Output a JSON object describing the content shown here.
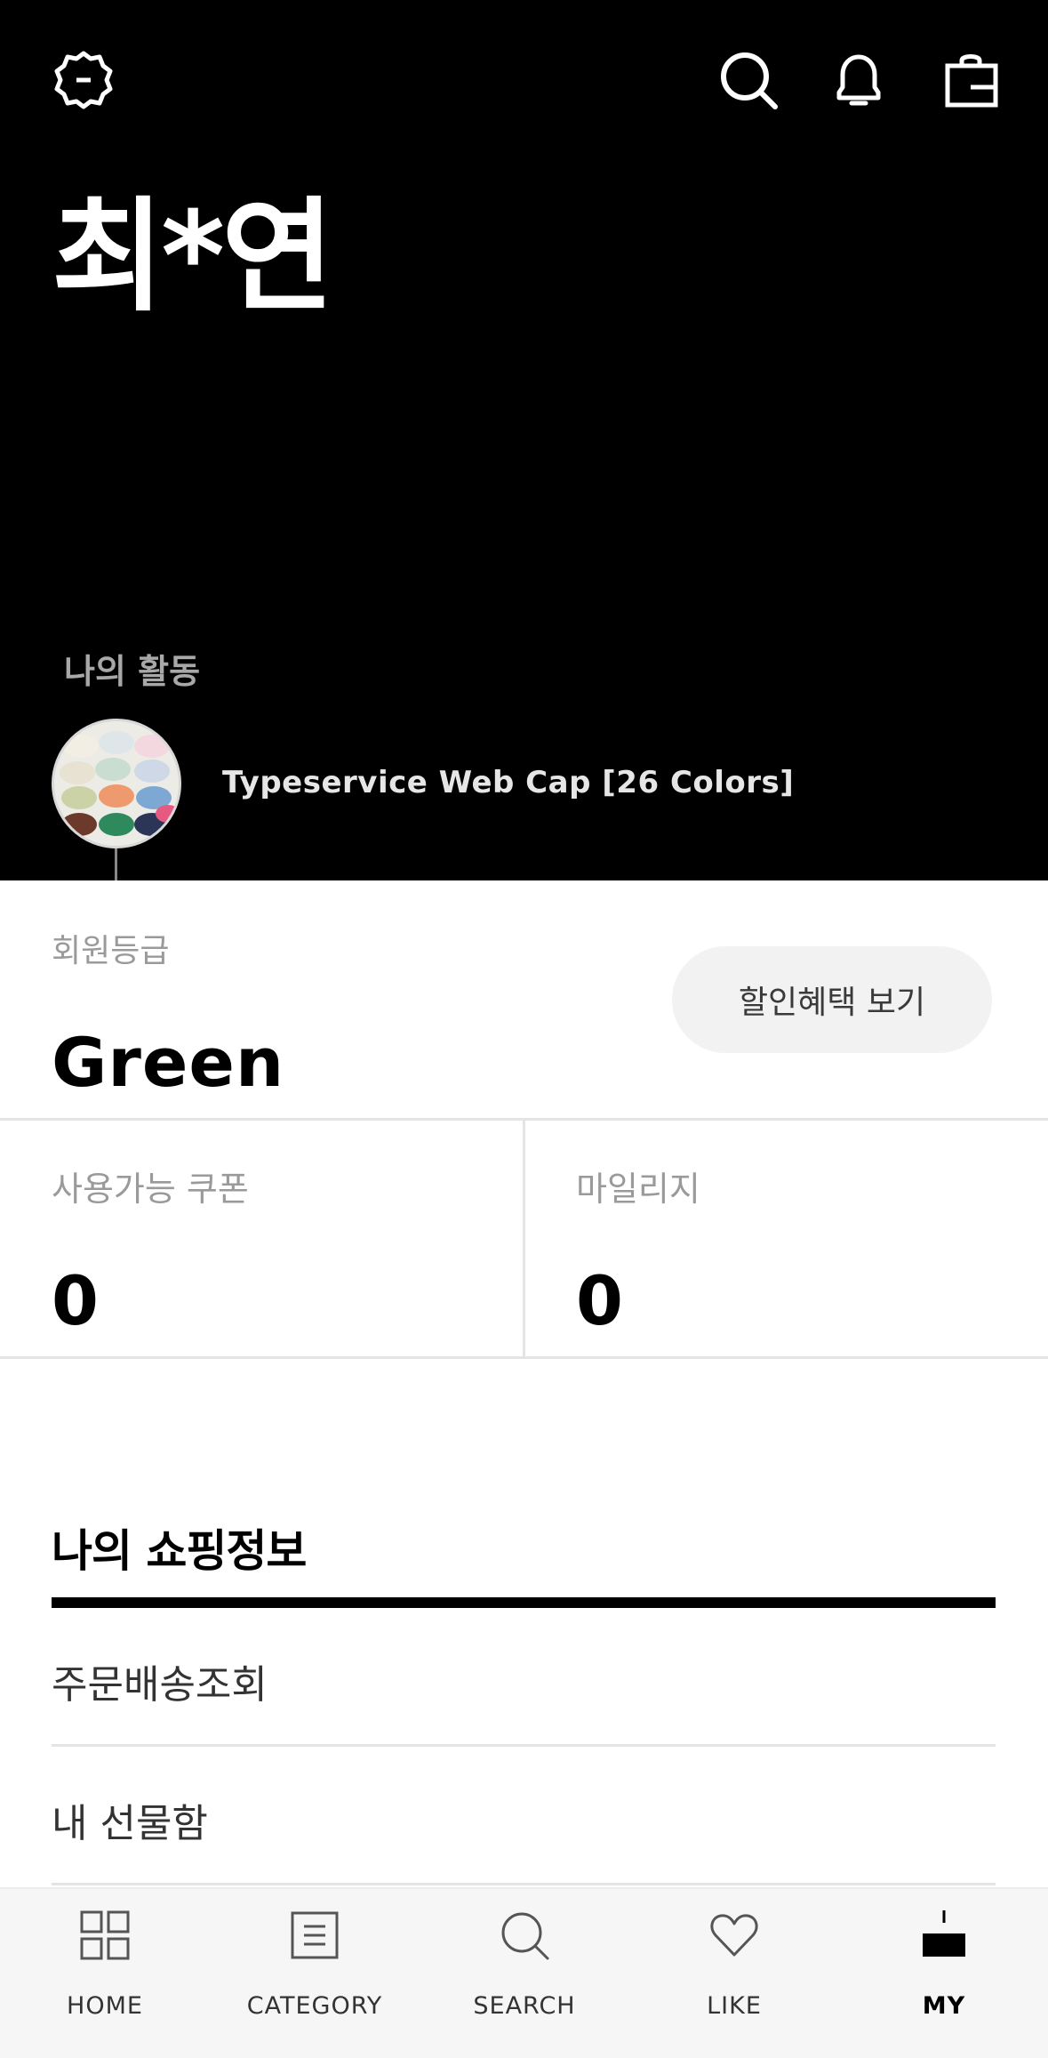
{
  "header": {
    "username": "최*연",
    "icons": [
      "settings-icon",
      "search-icon",
      "bell-icon",
      "shopping-bag-icon"
    ]
  },
  "activity": {
    "label": "나의 활동",
    "item_title": "Typeservice Web Cap [26 Colors]"
  },
  "membership": {
    "grade_label": "회원등급",
    "grade_value": "Green",
    "benefit_button": "할인혜택 보기"
  },
  "stats": {
    "coupon_label": "사용가능 쿠폰",
    "coupon_value": "0",
    "mileage_label": "마일리지",
    "mileage_value": "0"
  },
  "shopping_info": {
    "title": "나의 쇼핑정보",
    "items": [
      "주문배송조회",
      "내 선물함"
    ]
  },
  "bottom_nav": {
    "items": [
      {
        "label": "HOME",
        "icon": "home-grid-icon"
      },
      {
        "label": "CATEGORY",
        "icon": "category-list-icon"
      },
      {
        "label": "SEARCH",
        "icon": "search-icon"
      },
      {
        "label": "LIKE",
        "icon": "heart-icon"
      },
      {
        "label": "MY",
        "icon": "my-page-icon"
      }
    ],
    "active": "MY"
  },
  "colors": {
    "header_bg": "#000000",
    "button_bg": "#f2f2f2",
    "muted_text": "#9a9a9a"
  }
}
